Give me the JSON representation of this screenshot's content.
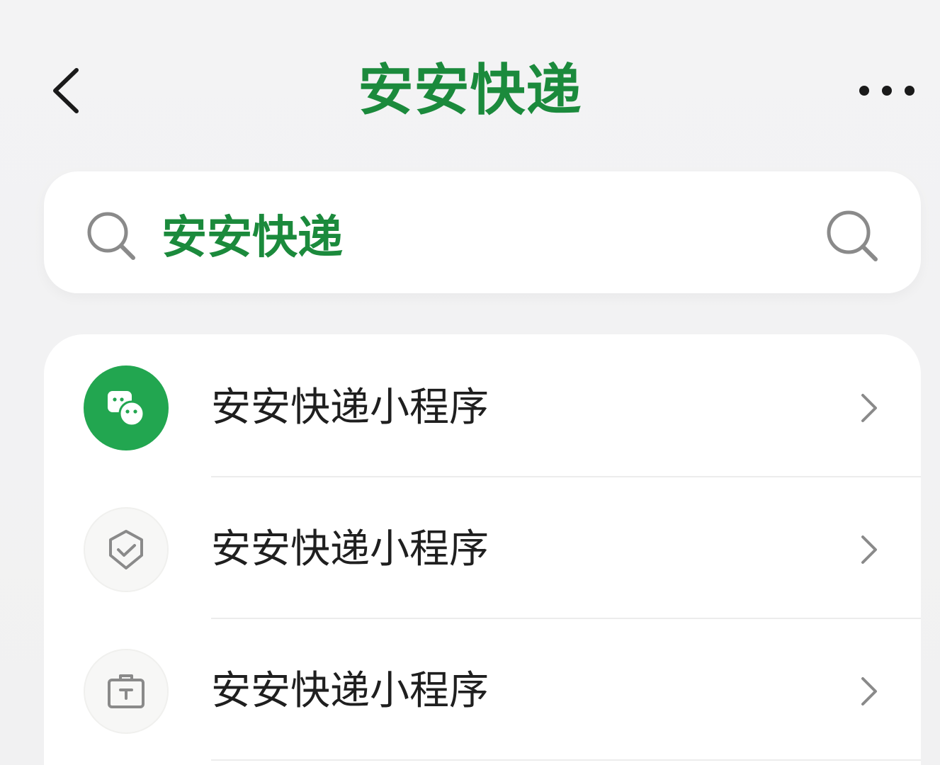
{
  "header": {
    "title": "安安快递",
    "back_icon": "chevron-left-icon",
    "more_icon": "more-dots-icon"
  },
  "search": {
    "value": "安安快递",
    "left_icon": "search-icon",
    "right_icon": "search-icon"
  },
  "results": [
    {
      "label": "安安快递小程序",
      "icon": "mini-program-icon",
      "icon_style": "green"
    },
    {
      "label": "安安快递小程序",
      "icon": "shield-check-icon",
      "icon_style": "light"
    },
    {
      "label": "安安快递小程序",
      "icon": "briefcase-icon",
      "icon_style": "light"
    }
  ],
  "colors": {
    "accent_green": "#1b8a3c",
    "icon_green": "#22a650",
    "text_dark": "#1f1f1f",
    "icon_gray": "#8a8a8a"
  }
}
